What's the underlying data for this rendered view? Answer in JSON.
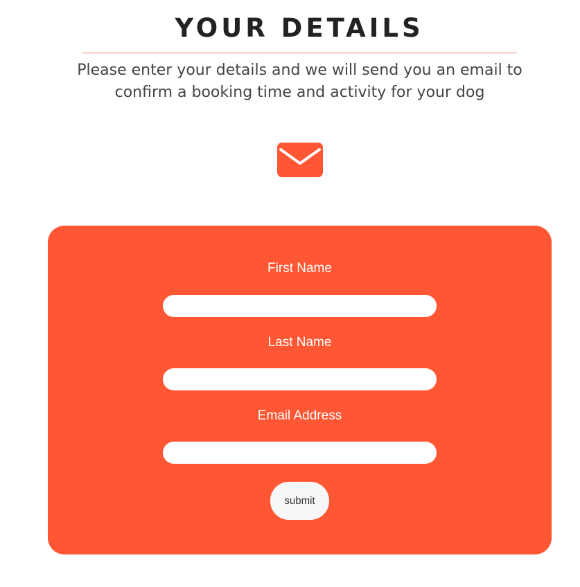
{
  "header": {
    "title": "YOUR DETAILS",
    "subtitle": "Please enter your details and we will send you an email to confirm a booking time and activity for your dog"
  },
  "icon": {
    "name": "envelope-icon",
    "color": "#ff5733"
  },
  "form": {
    "background_color": "#ff5733",
    "fields": [
      {
        "label": "First Name",
        "value": "",
        "placeholder": ""
      },
      {
        "label": "Last Name",
        "value": "",
        "placeholder": ""
      },
      {
        "label": "Email Address",
        "value": "",
        "placeholder": ""
      }
    ],
    "submit_label": "submit"
  }
}
